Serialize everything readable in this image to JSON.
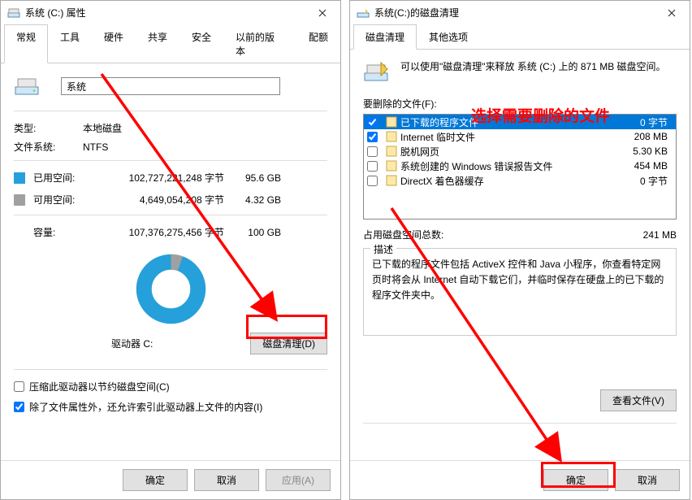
{
  "left": {
    "title": "系统 (C:) 属性",
    "tabs": [
      "常规",
      "工具",
      "硬件",
      "共享",
      "安全",
      "以前的版本",
      "配额"
    ],
    "active_tab": "常规",
    "volume_name": "系统",
    "type_lbl": "类型:",
    "type_val": "本地磁盘",
    "fs_lbl": "文件系统:",
    "fs_val": "NTFS",
    "used_lbl": "已用空间:",
    "used_bytes": "102,727,221,248 字节",
    "used_gb": "95.6 GB",
    "free_lbl": "可用空间:",
    "free_bytes": "4,649,054,208 字节",
    "free_gb": "4.32 GB",
    "cap_lbl": "容量:",
    "cap_bytes": "107,376,275,456 字节",
    "cap_gb": "100 GB",
    "drive_label": "驱动器 C:",
    "cleanup_btn": "磁盘清理(D)",
    "compress_chk": "压缩此驱动器以节约磁盘空间(C)",
    "allowindex_chk": "除了文件属性外，还允许索引此驱动器上文件的内容(I)",
    "ok": "确定",
    "cancel": "取消",
    "apply": "应用(A)"
  },
  "right": {
    "title": "系统(C:)的磁盘清理",
    "tabs": [
      "磁盘清理",
      "其他选项"
    ],
    "active_tab": "磁盘清理",
    "intro": "可以使用\"磁盘清理\"来释放 系统 (C:) 上的 871 MB 磁盘空间。",
    "files_lbl": "要删除的文件(F):",
    "files": [
      {
        "checked": true,
        "name": "已下载的程序文件",
        "size": "0 字节",
        "selected": true,
        "sz_light": true
      },
      {
        "checked": true,
        "name": "Internet 临时文件",
        "size": "208 MB"
      },
      {
        "checked": false,
        "name": "脱机网页",
        "size": "5.30 KB"
      },
      {
        "checked": false,
        "name": "系统创建的 Windows 错误报告文件",
        "size": "454 MB"
      },
      {
        "checked": false,
        "name": "DirectX 着色器缓存",
        "size": "0 字节"
      }
    ],
    "total_lbl": "占用磁盘空间总数:",
    "total_val": "241 MB",
    "desc_title": "描述",
    "desc_text": "已下载的程序文件包括 ActiveX 控件和 Java 小程序，你查看特定网页时将会从 Internet 自动下载它们，并临时保存在硬盘上的已下载的程序文件夹中。",
    "viewfiles": "查看文件(V)",
    "ok": "确定",
    "cancel": "取消",
    "annotation": "选择需要删除的文件"
  }
}
